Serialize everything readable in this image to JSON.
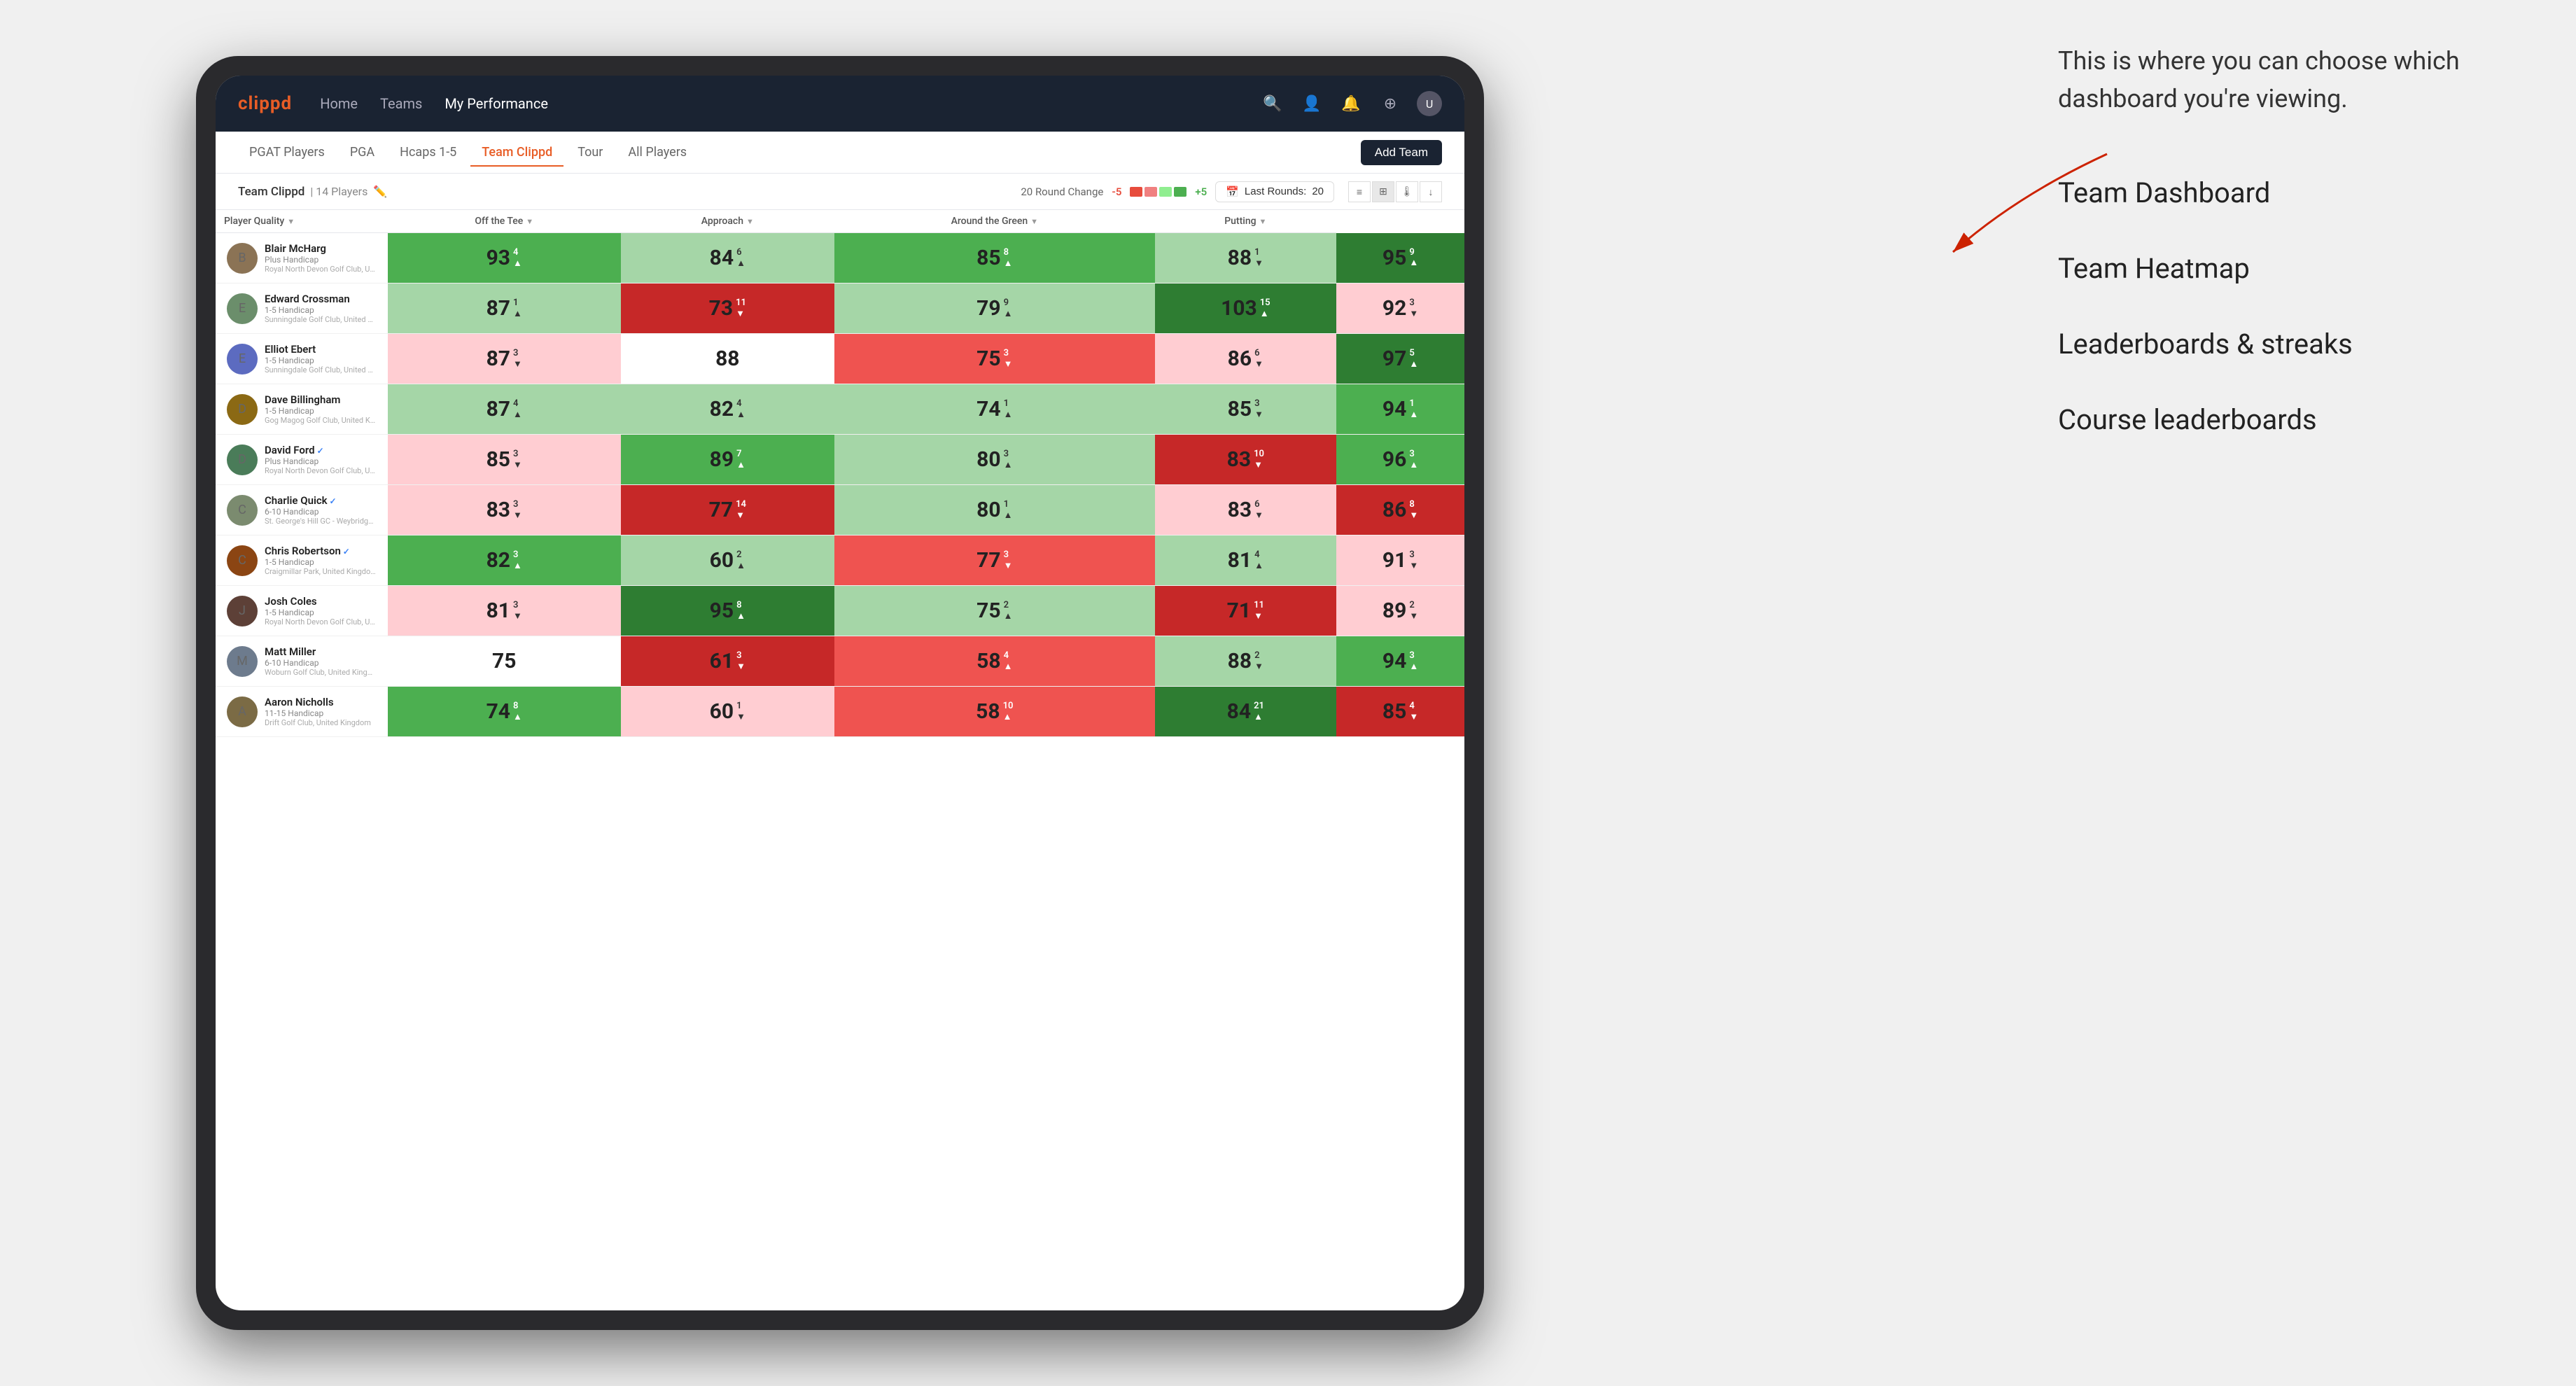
{
  "annotation": {
    "description": "This is where you can choose which dashboard you're viewing.",
    "menu_items": [
      "Team Dashboard",
      "Team Heatmap",
      "Leaderboards & streaks",
      "Course leaderboards"
    ]
  },
  "navbar": {
    "logo": "clippd",
    "links": [
      "Home",
      "Teams",
      "My Performance"
    ],
    "active_link": "My Performance"
  },
  "secondary_nav": {
    "tabs": [
      "PGAT Players",
      "PGA",
      "Hcaps 1-5",
      "Team Clippd",
      "Tour",
      "All Players"
    ],
    "active_tab": "Team Clippd",
    "add_team_label": "Add Team"
  },
  "team_header": {
    "name": "Team Clippd",
    "count": "14 Players",
    "round_change_label": "20 Round Change",
    "change_neg": "-5",
    "change_pos": "+5",
    "last_rounds_label": "Last Rounds:",
    "last_rounds_value": "20"
  },
  "table": {
    "columns": [
      {
        "id": "player",
        "label": "Player Quality",
        "has_arrow": true
      },
      {
        "id": "off_tee",
        "label": "Off the Tee",
        "has_arrow": true
      },
      {
        "id": "approach",
        "label": "Approach",
        "has_arrow": true
      },
      {
        "id": "around_green",
        "label": "Around the Green",
        "has_arrow": true
      },
      {
        "id": "putting",
        "label": "Putting",
        "has_arrow": true
      }
    ],
    "rows": [
      {
        "name": "Blair McHarg",
        "handicap": "Plus Handicap",
        "club": "Royal North Devon Golf Club, United Kingdom",
        "avatar_color": "#8B7355",
        "scores": [
          {
            "value": 93,
            "change": 4,
            "dir": "up",
            "heat": "heat-green"
          },
          {
            "value": 84,
            "change": 6,
            "dir": "up",
            "heat": "heat-light-green"
          },
          {
            "value": 85,
            "change": 8,
            "dir": "up",
            "heat": "heat-green"
          },
          {
            "value": 88,
            "change": 1,
            "dir": "down",
            "heat": "heat-light-green"
          },
          {
            "value": 95,
            "change": 9,
            "dir": "up",
            "heat": "heat-dark-green"
          }
        ]
      },
      {
        "name": "Edward Crossman",
        "handicap": "1-5 Handicap",
        "club": "Sunningdale Golf Club, United Kingdom",
        "avatar_color": "#6B8E6B",
        "scores": [
          {
            "value": 87,
            "change": 1,
            "dir": "up",
            "heat": "heat-light-green"
          },
          {
            "value": 73,
            "change": 11,
            "dir": "down",
            "heat": "heat-dark-red"
          },
          {
            "value": 79,
            "change": 9,
            "dir": "up",
            "heat": "heat-light-green"
          },
          {
            "value": 103,
            "change": 15,
            "dir": "up",
            "heat": "heat-dark-green"
          },
          {
            "value": 92,
            "change": 3,
            "dir": "down",
            "heat": "heat-light-red"
          }
        ]
      },
      {
        "name": "Elliot Ebert",
        "handicap": "1-5 Handicap",
        "club": "Sunningdale Golf Club, United Kingdom",
        "avatar_color": "#5C6BC0",
        "scores": [
          {
            "value": 87,
            "change": 3,
            "dir": "down",
            "heat": "heat-light-red"
          },
          {
            "value": 88,
            "change": null,
            "dir": null,
            "heat": "heat-white"
          },
          {
            "value": 75,
            "change": 3,
            "dir": "down",
            "heat": "heat-red"
          },
          {
            "value": 86,
            "change": 6,
            "dir": "down",
            "heat": "heat-light-red"
          },
          {
            "value": 97,
            "change": 5,
            "dir": "up",
            "heat": "heat-dark-green"
          }
        ]
      },
      {
        "name": "Dave Billingham",
        "handicap": "1-5 Handicap",
        "club": "Gog Magog Golf Club, United Kingdom",
        "avatar_color": "#8B6914",
        "scores": [
          {
            "value": 87,
            "change": 4,
            "dir": "up",
            "heat": "heat-light-green"
          },
          {
            "value": 82,
            "change": 4,
            "dir": "up",
            "heat": "heat-light-green"
          },
          {
            "value": 74,
            "change": 1,
            "dir": "up",
            "heat": "heat-light-green"
          },
          {
            "value": 85,
            "change": 3,
            "dir": "down",
            "heat": "heat-light-green"
          },
          {
            "value": 94,
            "change": 1,
            "dir": "up",
            "heat": "heat-green"
          }
        ]
      },
      {
        "name": "David Ford",
        "handicap": "Plus Handicap",
        "club": "Royal North Devon Golf Club, United Kingdom",
        "avatar_color": "#4A7C59",
        "verified": true,
        "scores": [
          {
            "value": 85,
            "change": 3,
            "dir": "down",
            "heat": "heat-light-red"
          },
          {
            "value": 89,
            "change": 7,
            "dir": "up",
            "heat": "heat-green"
          },
          {
            "value": 80,
            "change": 3,
            "dir": "up",
            "heat": "heat-light-green"
          },
          {
            "value": 83,
            "change": 10,
            "dir": "down",
            "heat": "heat-dark-red"
          },
          {
            "value": 96,
            "change": 3,
            "dir": "up",
            "heat": "heat-green"
          }
        ]
      },
      {
        "name": "Charlie Quick",
        "handicap": "6-10 Handicap",
        "club": "St. George's Hill GC - Weybridge - Surrey, Uni...",
        "avatar_color": "#7B8B6F",
        "verified": true,
        "scores": [
          {
            "value": 83,
            "change": 3,
            "dir": "down",
            "heat": "heat-light-red"
          },
          {
            "value": 77,
            "change": 14,
            "dir": "down",
            "heat": "heat-dark-red"
          },
          {
            "value": 80,
            "change": 1,
            "dir": "up",
            "heat": "heat-light-green"
          },
          {
            "value": 83,
            "change": 6,
            "dir": "down",
            "heat": "heat-light-red"
          },
          {
            "value": 86,
            "change": 8,
            "dir": "down",
            "heat": "heat-dark-red"
          }
        ]
      },
      {
        "name": "Chris Robertson",
        "handicap": "1-5 Handicap",
        "club": "Craigmillar Park, United Kingdom",
        "avatar_color": "#8B4513",
        "verified": true,
        "scores": [
          {
            "value": 82,
            "change": 3,
            "dir": "up",
            "heat": "heat-green"
          },
          {
            "value": 60,
            "change": 2,
            "dir": "up",
            "heat": "heat-light-green"
          },
          {
            "value": 77,
            "change": 3,
            "dir": "down",
            "heat": "heat-red"
          },
          {
            "value": 81,
            "change": 4,
            "dir": "up",
            "heat": "heat-light-green"
          },
          {
            "value": 91,
            "change": 3,
            "dir": "down",
            "heat": "heat-light-red"
          }
        ]
      },
      {
        "name": "Josh Coles",
        "handicap": "1-5 Handicap",
        "club": "Royal North Devon Golf Club, United Kingdom",
        "avatar_color": "#5D4037",
        "scores": [
          {
            "value": 81,
            "change": 3,
            "dir": "down",
            "heat": "heat-light-red"
          },
          {
            "value": 95,
            "change": 8,
            "dir": "up",
            "heat": "heat-dark-green"
          },
          {
            "value": 75,
            "change": 2,
            "dir": "up",
            "heat": "heat-light-green"
          },
          {
            "value": 71,
            "change": 11,
            "dir": "down",
            "heat": "heat-dark-red"
          },
          {
            "value": 89,
            "change": 2,
            "dir": "down",
            "heat": "heat-light-red"
          }
        ]
      },
      {
        "name": "Matt Miller",
        "handicap": "6-10 Handicap",
        "club": "Woburn Golf Club, United Kingdom",
        "avatar_color": "#6D7B8D",
        "scores": [
          {
            "value": 75,
            "change": null,
            "dir": null,
            "heat": "heat-white"
          },
          {
            "value": 61,
            "change": 3,
            "dir": "down",
            "heat": "heat-dark-red"
          },
          {
            "value": 58,
            "change": 4,
            "dir": "up",
            "heat": "heat-red"
          },
          {
            "value": 88,
            "change": 2,
            "dir": "down",
            "heat": "heat-light-green"
          },
          {
            "value": 94,
            "change": 3,
            "dir": "up",
            "heat": "heat-green"
          }
        ]
      },
      {
        "name": "Aaron Nicholls",
        "handicap": "11-15 Handicap",
        "club": "Drift Golf Club, United Kingdom",
        "avatar_color": "#7B6B45",
        "scores": [
          {
            "value": 74,
            "change": 8,
            "dir": "up",
            "heat": "heat-green"
          },
          {
            "value": 60,
            "change": 1,
            "dir": "down",
            "heat": "heat-light-red"
          },
          {
            "value": 58,
            "change": 10,
            "dir": "up",
            "heat": "heat-red"
          },
          {
            "value": 84,
            "change": 21,
            "dir": "up",
            "heat": "heat-dark-green"
          },
          {
            "value": 85,
            "change": 4,
            "dir": "down",
            "heat": "heat-dark-red"
          }
        ]
      }
    ]
  }
}
